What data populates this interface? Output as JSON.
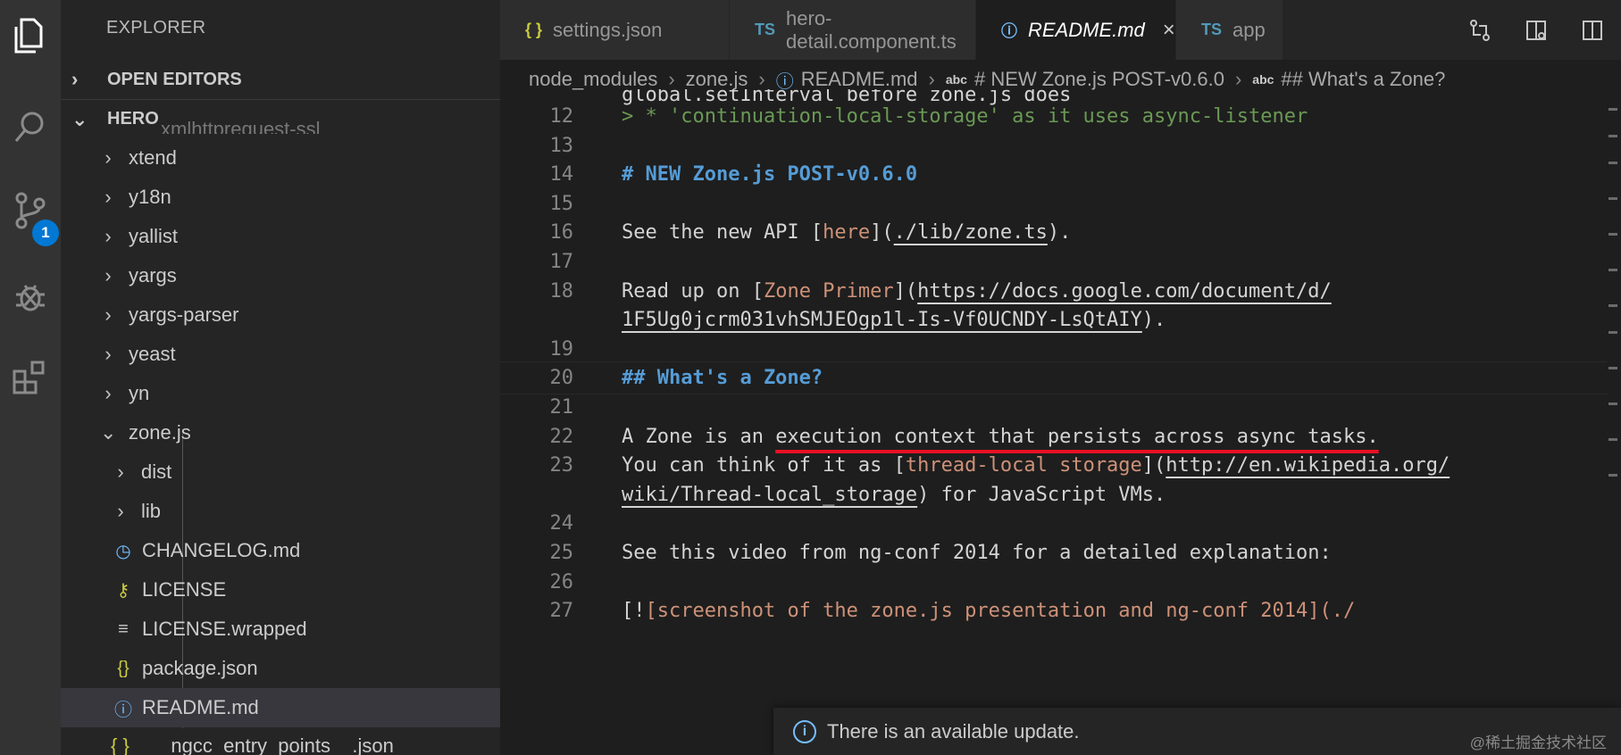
{
  "sidebar": {
    "title": "EXPLORER",
    "open_editors": "OPEN EDITORS",
    "workspace": "HERO",
    "partial_top": "xmlhttprequest-ssl",
    "tree": [
      {
        "label": "xtend",
        "type": "folder",
        "depth": 1
      },
      {
        "label": "y18n",
        "type": "folder",
        "depth": 1
      },
      {
        "label": "yallist",
        "type": "folder",
        "depth": 1
      },
      {
        "label": "yargs",
        "type": "folder",
        "depth": 1
      },
      {
        "label": "yargs-parser",
        "type": "folder",
        "depth": 1
      },
      {
        "label": "yeast",
        "type": "folder",
        "depth": 1
      },
      {
        "label": "yn",
        "type": "folder",
        "depth": 1
      },
      {
        "label": "zone.js",
        "type": "folder-open",
        "depth": 1
      },
      {
        "label": "dist",
        "type": "folder",
        "depth": 2
      },
      {
        "label": "lib",
        "type": "folder",
        "depth": 2
      },
      {
        "label": "CHANGELOG.md",
        "type": "changelog",
        "depth": 2
      },
      {
        "label": "LICENSE",
        "type": "license",
        "depth": 2
      },
      {
        "label": "LICENSE.wrapped",
        "type": "text",
        "depth": 2
      },
      {
        "label": "package.json",
        "type": "json",
        "depth": 2
      },
      {
        "label": "README.md",
        "type": "readme",
        "depth": 2,
        "selected": true
      }
    ],
    "bottom_item": "__ngcc_entry_points__.json"
  },
  "activity": {
    "scm_badge": "1"
  },
  "tabs": [
    {
      "label": "settings.json",
      "icon": "{ }",
      "active": false
    },
    {
      "label": "hero-detail.component.ts",
      "icon": "TS",
      "active": false
    },
    {
      "label": "README.md",
      "icon": "ⓘ",
      "active": true
    },
    {
      "label": "app",
      "icon": "TS",
      "active": false
    }
  ],
  "breadcrumb": {
    "parts": [
      "node_modules",
      "zone.js",
      "README.md",
      "# NEW Zone.js POST-v0.6.0",
      "## What's a Zone?"
    ],
    "abc": "abc"
  },
  "code": {
    "partial_top": "global.setInterval before zone.js does",
    "lines": [
      {
        "n": "12",
        "a": "> * 'continuation-local-storage' as it uses async-listener"
      },
      {
        "n": "13",
        "a": ""
      },
      {
        "n": "14",
        "a": "# NEW Zone.js POST-v0.6.0"
      },
      {
        "n": "15",
        "a": ""
      },
      {
        "n": "16",
        "a": "See the new API [",
        "b": "here",
        "c": "](",
        "d": "./lib/zone.ts",
        "e": ")."
      },
      {
        "n": "17",
        "a": ""
      },
      {
        "n": "18",
        "a": "Read up on [",
        "b": "Zone Primer",
        "c": "](",
        "d": "https://docs.google.com/document/d/"
      },
      {
        "n": "",
        "d": "1F5Ug0jcrm031vhSMJEOgp1l-Is-Vf0UCNDY-LsQtAIY",
        "e": ")."
      },
      {
        "n": "19",
        "a": ""
      },
      {
        "n": "20",
        "a": "## What's a Zone?"
      },
      {
        "n": "21",
        "a": ""
      },
      {
        "n": "22",
        "a": "A Zone is an ",
        "b": "execution context that persists across async tasks."
      },
      {
        "n": "23",
        "a": "You can think of it as [",
        "b": "thread-local storage",
        "c": "](",
        "d": "http://en.wikipedia.org/"
      },
      {
        "n": "",
        "d": "wiki/Thread-local_storage",
        "e": ") for JavaScript VMs."
      },
      {
        "n": "24",
        "a": ""
      },
      {
        "n": "25",
        "a": "See this video from ng-conf 2014 for a detailed explanation:"
      },
      {
        "n": "26",
        "a": ""
      },
      {
        "n": "27",
        "a": "[!",
        "b": "[screenshot of the zone.js presentation and ng-conf 2014](./"
      }
    ]
  },
  "notification": {
    "text": "There is an available update."
  },
  "watermark": "@稀土掘金技术社区",
  "colors": {
    "accent": "#0078d4",
    "heading": "#569cd6",
    "link": "#ce9178",
    "underline": "#e81123"
  }
}
